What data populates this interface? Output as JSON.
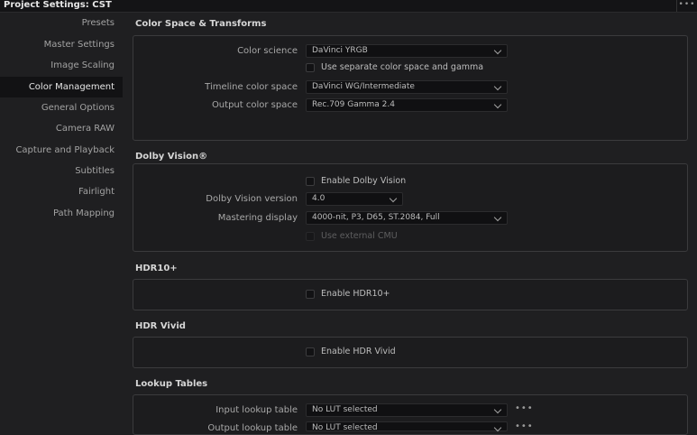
{
  "window": {
    "title": "Project Settings:  CST",
    "menu_icon": "•••"
  },
  "sidebar": {
    "items": [
      {
        "label": "Presets"
      },
      {
        "label": "Master Settings"
      },
      {
        "label": "Image Scaling"
      },
      {
        "label": "Color Management",
        "active": true
      },
      {
        "label": "General Options"
      },
      {
        "label": "Camera RAW"
      },
      {
        "label": "Capture and Playback"
      },
      {
        "label": "Subtitles"
      },
      {
        "label": "Fairlight"
      },
      {
        "label": "Path Mapping"
      }
    ]
  },
  "color_space": {
    "title": "Color Space & Transforms",
    "color_science_label": "Color science",
    "color_science_value": "DaVinci YRGB",
    "separate_label": "Use separate color space and gamma",
    "timeline_label": "Timeline color space",
    "timeline_value": "DaVinci WG/Intermediate",
    "output_label": "Output color space",
    "output_value": "Rec.709 Gamma 2.4"
  },
  "dolby": {
    "title": "Dolby Vision®",
    "enable_label": "Enable Dolby Vision",
    "version_label": "Dolby Vision version",
    "version_value": "4.0",
    "mastering_label": "Mastering display",
    "mastering_value": "4000-nit, P3, D65, ST.2084, Full",
    "cmu_label": "Use external CMU"
  },
  "hdr10": {
    "title": "HDR10+",
    "enable_label": "Enable HDR10+"
  },
  "hdrvivid": {
    "title": "HDR Vivid",
    "enable_label": "Enable HDR Vivid"
  },
  "lut": {
    "title": "Lookup Tables",
    "input_label": "Input lookup table",
    "input_value": "No LUT selected",
    "output_label": "Output lookup table",
    "output_value": "No LUT selected",
    "more_icon": "•••"
  }
}
